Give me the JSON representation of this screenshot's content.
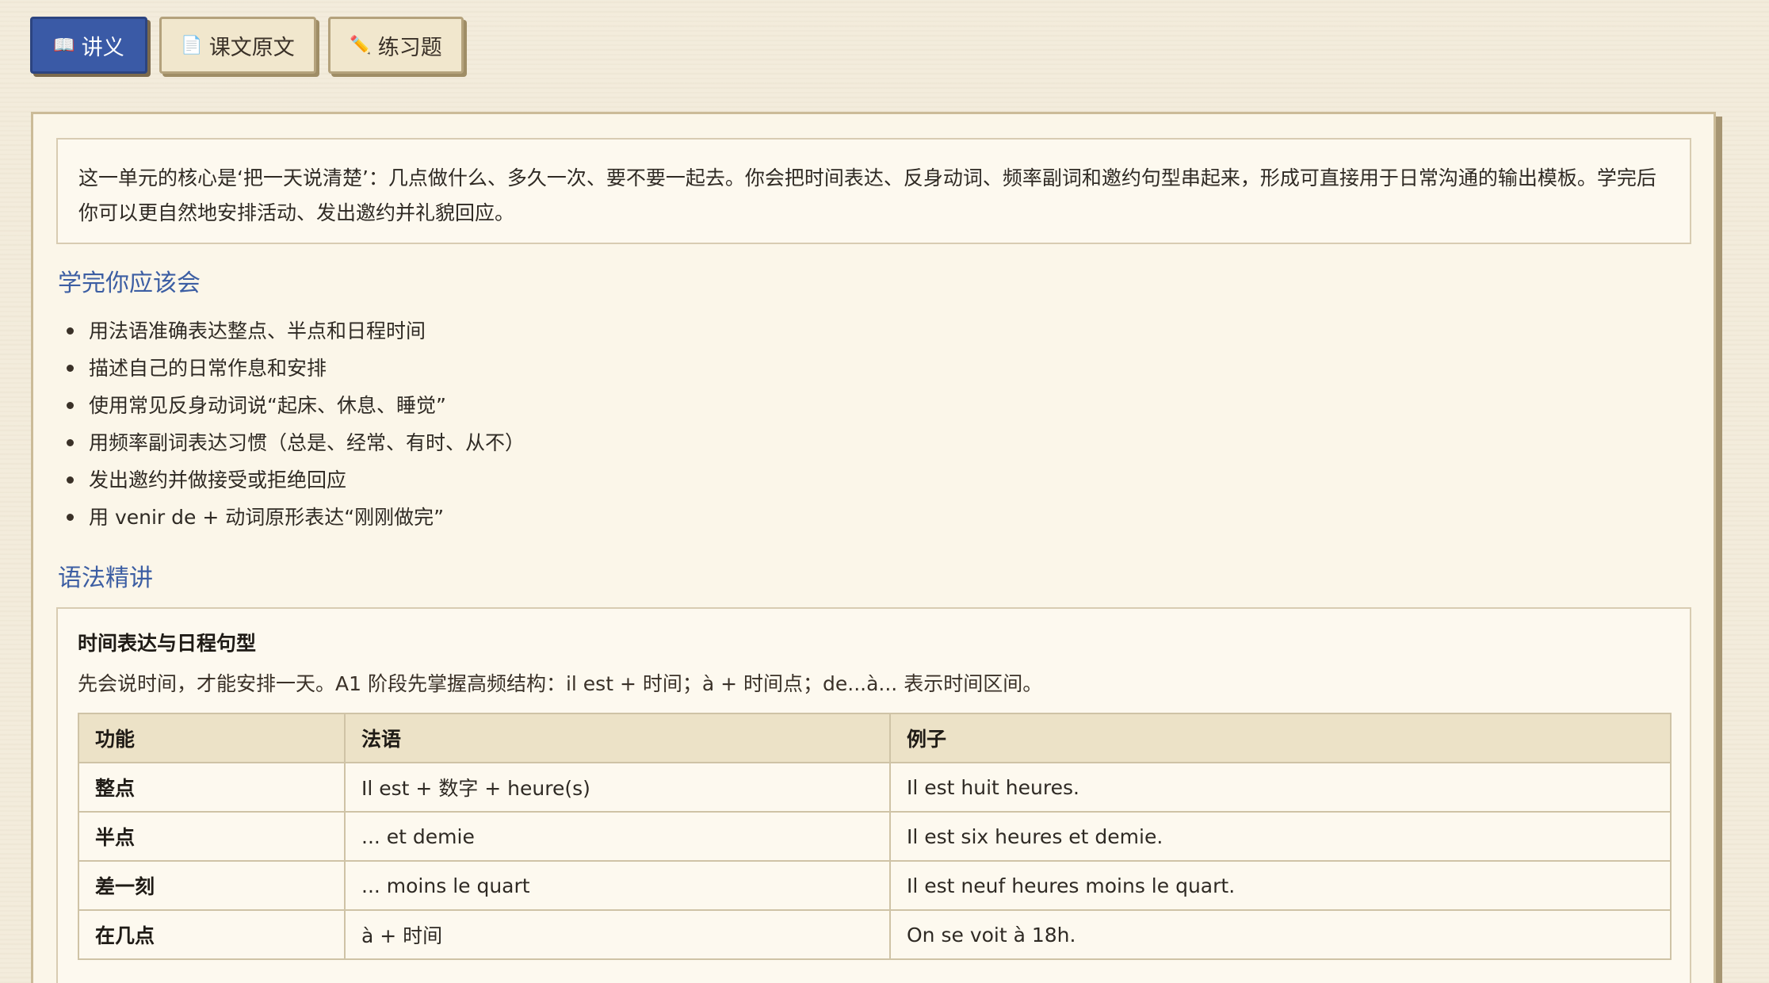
{
  "tabs": [
    {
      "icon": "📖",
      "label": "讲义",
      "active": true
    },
    {
      "icon": "📄",
      "label": "课文原文",
      "active": false
    },
    {
      "icon": "✏️",
      "label": "练习题",
      "active": false
    }
  ],
  "intro": "这一单元的核心是‘把一天说清楚’：几点做什么、多久一次、要不要一起去。你会把时间表达、反身动词、频率副词和邀约句型串起来，形成可直接用于日常沟通的输出模板。学完后你可以更自然地安排活动、发出邀约并礼貌回应。",
  "goals": {
    "title": "学完你应该会",
    "items": [
      "用法语准确表达整点、半点和日程时间",
      "描述自己的日常作息和安排",
      "使用常见反身动词说“起床、休息、睡觉”",
      "用频率副词表达习惯（总是、经常、有时、从不）",
      "发出邀约并做接受或拒绝回应",
      "用 venir de + 动词原形表达“刚刚做完”"
    ]
  },
  "grammar": {
    "title": "语法精讲",
    "card": {
      "title": "时间表达与日程句型",
      "desc": "先会说时间，才能安排一天。A1 阶段先掌握高频结构：il est + 时间；à + 时间点；de...à... 表示时间区间。",
      "headers": [
        "功能",
        "法语",
        "例子"
      ],
      "rows": [
        [
          "整点",
          "Il est + 数字 + heure(s)",
          "Il est huit heures."
        ],
        [
          "半点",
          "... et demie",
          "Il est six heures et demie."
        ],
        [
          "差一刻",
          "... moins le quart",
          "Il est neuf heures moins le quart."
        ],
        [
          "在几点",
          "à + 时间",
          "On se voit à 18h."
        ]
      ]
    }
  },
  "colors": {
    "accent": "#3a5aa6",
    "section_title": "#3c5ea3",
    "background": "#f3ecdc",
    "panel": "#fbf6e9"
  }
}
